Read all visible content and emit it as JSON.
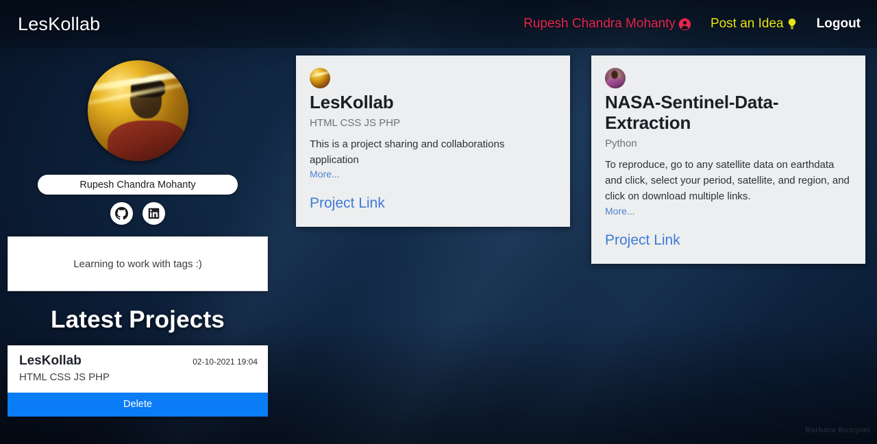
{
  "navbar": {
    "brand": "LesKollab",
    "links": [
      {
        "label": "Rupesh Chandra Mohanty",
        "icon": "user-circle-icon",
        "color": "#e8254a"
      },
      {
        "label": "Post an Idea",
        "icon": "lightbulb-icon",
        "color": "#e8e317"
      },
      {
        "label": "Logout",
        "icon": "",
        "color": "#ffffff"
      }
    ]
  },
  "sidebar": {
    "avatar_alt": "profile-photo",
    "name_badge": "Rupesh Chandra Mohanty",
    "social": [
      {
        "name": "github-icon",
        "label": "GitHub"
      },
      {
        "name": "linkedin-icon",
        "label": "LinkedIn"
      }
    ],
    "tagline": "Learning to work with tags :)",
    "latest_projects_title": "Latest Projects",
    "latest_projects": [
      {
        "name": "LesKollab",
        "date": "02-10-2021 19:04",
        "stack": "HTML CSS JS PHP",
        "delete_label": "Delete"
      }
    ]
  },
  "feed": {
    "cards": [
      {
        "avatar_style": "gold",
        "title": "LesKollab",
        "stack": "HTML CSS JS PHP",
        "description": "This is a project sharing and collaborations application",
        "more_label": "More...",
        "link_label": "Project Link"
      },
      {
        "avatar_style": "person",
        "title": "NASA-Sentinel-Data-Extraction",
        "stack": "Python",
        "description": "To reproduce, go to any satellite data on earthdata and click, select your period, satellite, and region, and click on download multiple links.",
        "more_label": "More...",
        "link_label": "Project Link"
      }
    ]
  },
  "desktop": {
    "watermark": "Barbara Busquet"
  },
  "colors": {
    "accent_blue": "#0a7cf5",
    "link_blue": "#3f7ad8",
    "user_red": "#e8254a",
    "idea_yellow": "#e8e317",
    "card_bg": "#eceeef",
    "page_bg": "#0a1930"
  }
}
